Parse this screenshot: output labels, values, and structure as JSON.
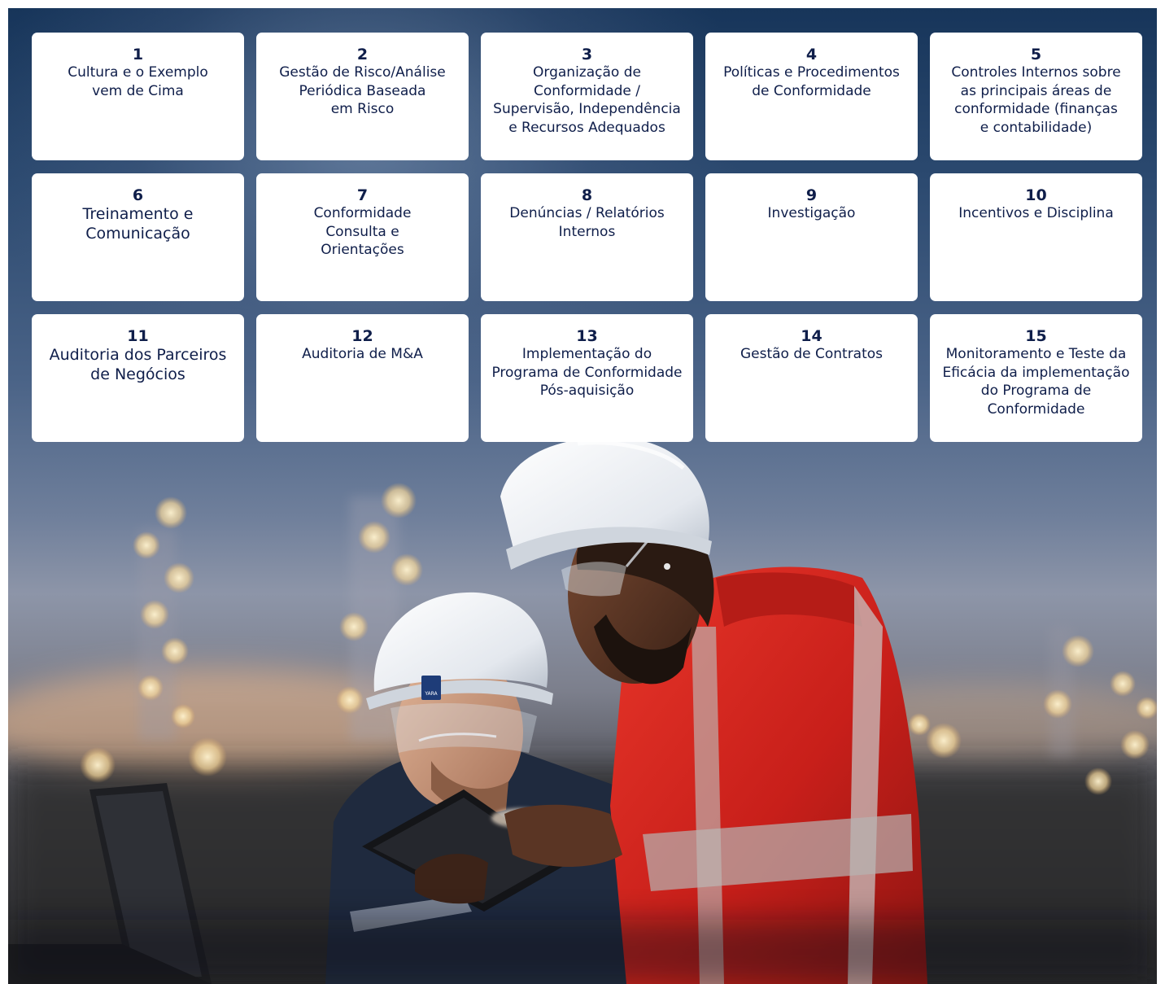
{
  "cards": [
    {
      "num": "1",
      "title": "Cultura e o Exemplo\nvem de Cima",
      "large": false
    },
    {
      "num": "2",
      "title": "Gestão de Risco/Análise\nPeriódica Baseada\nem Risco",
      "large": false
    },
    {
      "num": "3",
      "title": "Organização de\nConformidade /\nSupervisão, Independência\ne Recursos Adequados",
      "large": false
    },
    {
      "num": "4",
      "title": "Políticas e Procedimentos\nde Conformidade",
      "large": false
    },
    {
      "num": "5",
      "title": "Controles Internos sobre\nas principais áreas de\nconformidade (finanças\ne contabilidade)",
      "large": false
    },
    {
      "num": "6",
      "title": "Treinamento e\nComunicação",
      "large": true
    },
    {
      "num": "7",
      "title": "Conformidade\nConsulta e\nOrientações",
      "large": false
    },
    {
      "num": "8",
      "title": "Denúncias / Relatórios\nInternos",
      "large": false
    },
    {
      "num": "9",
      "title": "Investigação",
      "large": false
    },
    {
      "num": "10",
      "title": "Incentivos e Disciplina",
      "large": false
    },
    {
      "num": "11",
      "title": "Auditoria dos Parceiros\nde Negócios",
      "large": true
    },
    {
      "num": "12",
      "title": "Auditoria de M&A",
      "large": false
    },
    {
      "num": "13",
      "title": "Implementação do\nPrograma de Conformidade\nPós-aquisição",
      "large": false
    },
    {
      "num": "14",
      "title": "Gestão de Contratos",
      "large": false
    },
    {
      "num": "15",
      "title": "Monitoramento e Teste da\nEficácia da implementação\ndo Programa de\nConformidade",
      "large": false
    }
  ],
  "photo": {
    "helmet_logo": "YARA"
  },
  "colors": {
    "card_text": "#0f1e4a",
    "card_bg": "#ffffff",
    "sky_top": "#17355a",
    "jacket": "#d8241e"
  }
}
